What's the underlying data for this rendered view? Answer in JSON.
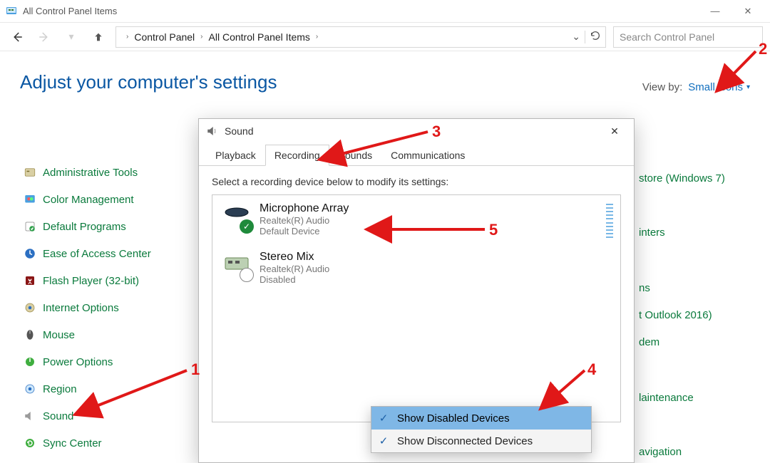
{
  "window": {
    "title": "All Control Panel Items",
    "min_label": "Minimize",
    "close_label": "Close"
  },
  "nav": {
    "breadcrumb": {
      "seg1": "Control Panel",
      "seg2": "All Control Panel Items"
    },
    "search_placeholder": "Search Control Panel"
  },
  "header": {
    "heading": "Adjust your computer's settings",
    "viewby_label": "View by:",
    "viewby_value": "Small icons"
  },
  "cp_items_left": [
    "Administrative Tools",
    "Color Management",
    "Default Programs",
    "Ease of Access Center",
    "Flash Player (32-bit)",
    "Internet Options",
    "Mouse",
    "Power Options",
    "Region",
    "Sound",
    "Sync Center"
  ],
  "cp_items_right_partial": [
    "store (Windows 7)",
    "inters",
    "ns",
    "t Outlook 2016)",
    "dem",
    "laintenance",
    "avigation"
  ],
  "dialog": {
    "title": "Sound",
    "tabs": {
      "playback": "Playback",
      "recording": "Recording",
      "sounds": "Sounds",
      "comms": "Communications"
    },
    "instruction": "Select a recording device below to modify its settings:",
    "devices": [
      {
        "name": "Microphone Array",
        "driver": "Realtek(R) Audio",
        "status": "Default Device",
        "badge": "ok"
      },
      {
        "name": "Stereo Mix",
        "driver": "Realtek(R) Audio",
        "status": "Disabled",
        "badge": "down"
      }
    ]
  },
  "context_menu": {
    "items": [
      {
        "label": "Show Disabled Devices",
        "checked": true,
        "selected": true
      },
      {
        "label": "Show Disconnected Devices",
        "checked": true,
        "selected": false
      }
    ]
  },
  "annotations": {
    "1": "1",
    "2": "2",
    "3": "3",
    "4": "4",
    "5": "5"
  }
}
